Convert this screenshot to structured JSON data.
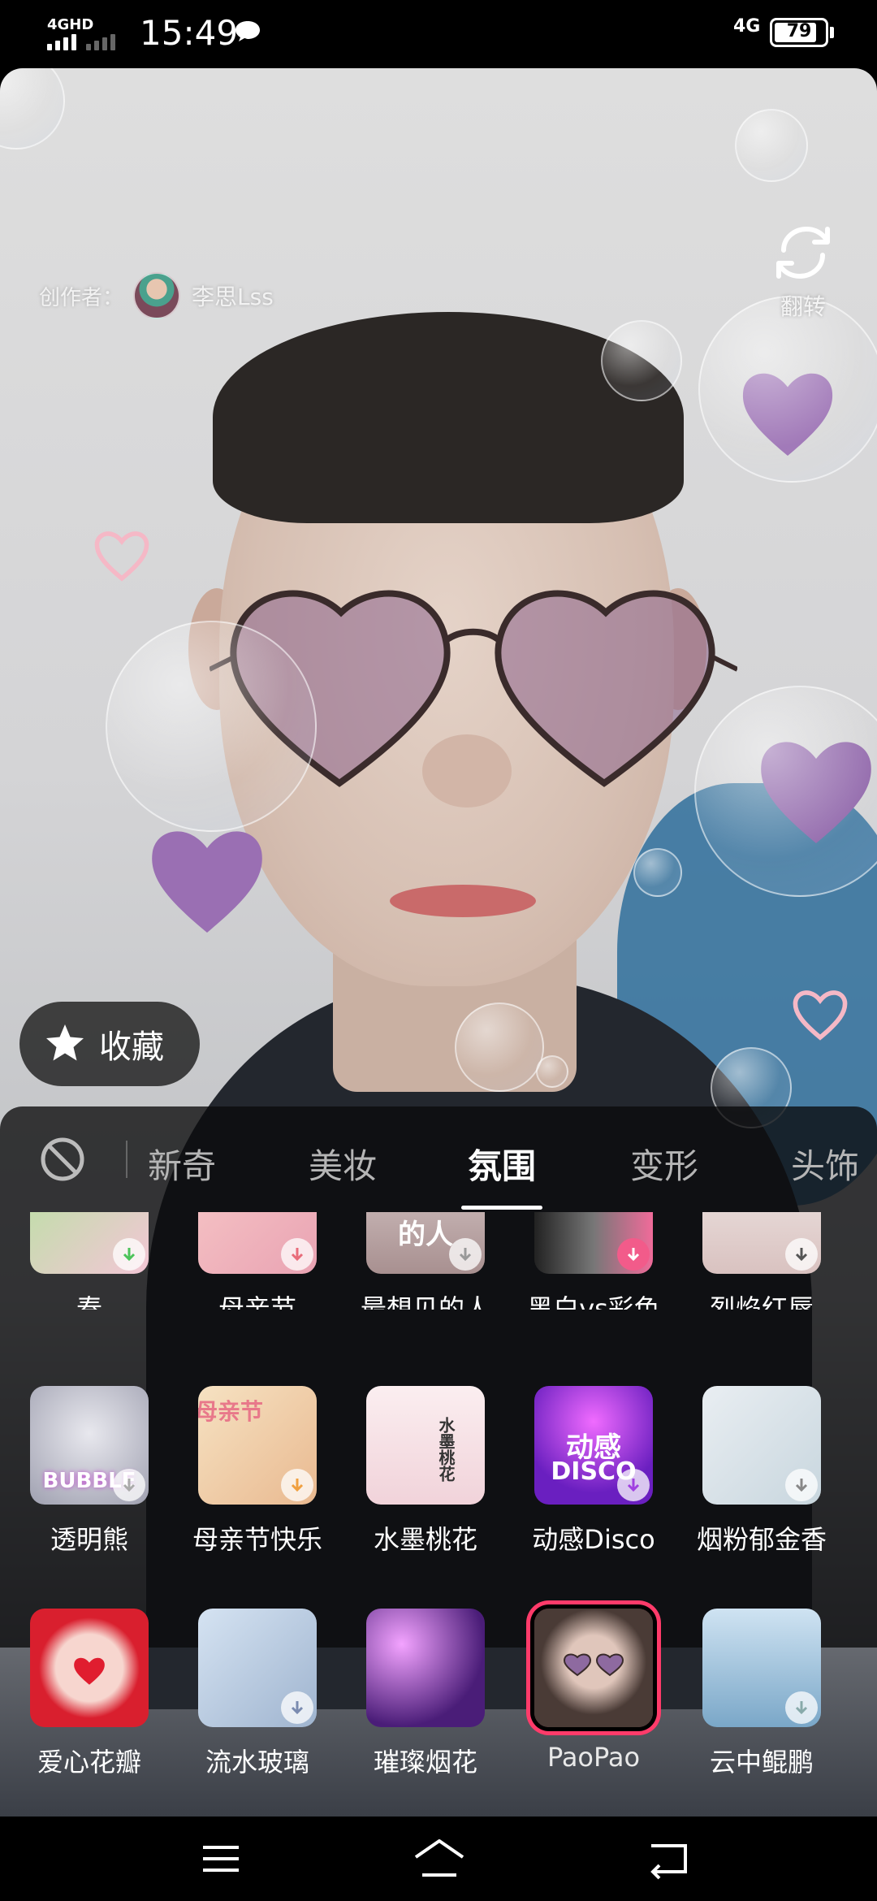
{
  "status_bar": {
    "network_label": "4GHD",
    "time": "15:49",
    "cell_label": "4G",
    "battery": "79"
  },
  "camera": {
    "creator_label": "创作者：",
    "creator_name": "李思Lss",
    "flip_label": "翻转",
    "favorite_label": "收藏"
  },
  "tabs": {
    "items": [
      "新奇",
      "美妆",
      "氛围",
      "变形",
      "头饰"
    ],
    "active": "氛围"
  },
  "effects": {
    "row1": [
      "春",
      "母亲节",
      "最想见的人",
      "黑白vs彩色",
      "烈焰红唇"
    ],
    "row2": [
      "透明熊",
      "母亲节快乐",
      "水墨桃花",
      "动感Disco",
      "烟粉郁金香"
    ],
    "row3": [
      "爱心花瓣",
      "流水玻璃",
      "璀璨烟花",
      "PaoPao",
      "云中鲲鹏"
    ],
    "selected": "PaoPao",
    "thumb_texts": {
      "bubble": "BUBBLE",
      "mother_day": "母亲节",
      "ink_peach": "水墨桃花",
      "disco_1": "动感",
      "disco_2": "DISCO",
      "want_to_see": "的人"
    }
  },
  "colors": {
    "accent_selected": "#ff3b6a",
    "download_badge_pink": "#f25b8a",
    "panel_bg": "#0a0a0c"
  },
  "icons": {
    "nav": [
      "menu-icon",
      "home-icon",
      "back-icon"
    ]
  }
}
